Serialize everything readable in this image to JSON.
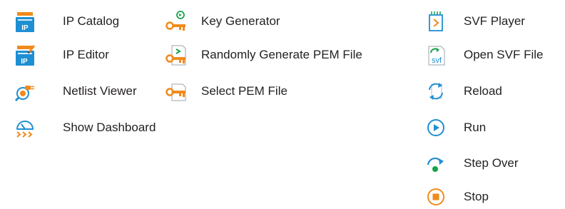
{
  "column1": {
    "ip_catalog": {
      "label": "IP Catalog",
      "icon": "ip-catalog-icon"
    },
    "ip_editor": {
      "label": "IP Editor",
      "icon": "ip-editor-icon"
    },
    "netlist_viewer": {
      "label": "Netlist Viewer",
      "icon": "netlist-viewer-icon"
    },
    "show_dashboard": {
      "label": "Show Dashboard",
      "icon": "dashboard-icon"
    }
  },
  "column2": {
    "key_generator": {
      "label": "Key Generator",
      "icon": "key-generator-icon"
    },
    "random_pem": {
      "label": "Randomly Generate PEM File",
      "icon": "random-pem-icon"
    },
    "select_pem": {
      "label": "Select PEM File",
      "icon": "select-pem-icon"
    }
  },
  "column3": {
    "svf_player": {
      "label": "SVF Player",
      "icon": "svf-player-icon"
    },
    "open_svf": {
      "label": "Open SVF File",
      "icon": "open-svf-icon",
      "badge": "svf"
    },
    "reload": {
      "label": "Reload",
      "icon": "reload-icon"
    },
    "run": {
      "label": "Run",
      "icon": "run-icon"
    },
    "step_over": {
      "label": "Step Over",
      "icon": "step-over-icon"
    },
    "stop": {
      "label": "Stop",
      "icon": "stop-icon"
    }
  },
  "colors": {
    "text": "#231f20",
    "blue": "#1f8fd3",
    "orange": "#f18a1d",
    "green": "#17a34a",
    "pale_blue": "#d9eefa"
  }
}
